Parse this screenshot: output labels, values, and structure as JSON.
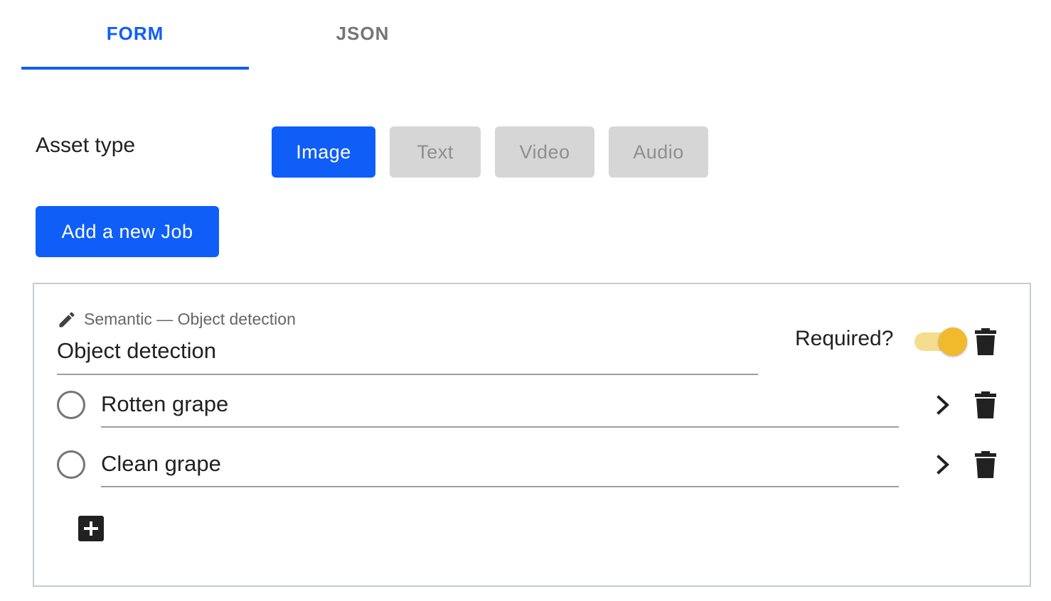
{
  "colors": {
    "accent": "#0f5ef7",
    "toggle_track": "#f5dd90",
    "toggle_thumb": "#f1b92c"
  },
  "tabs": [
    {
      "label": "FORM",
      "active": true
    },
    {
      "label": "JSON",
      "active": false
    }
  ],
  "asset_type": {
    "label": "Asset type",
    "options": [
      {
        "label": "Image",
        "active": true
      },
      {
        "label": "Text",
        "active": false
      },
      {
        "label": "Video",
        "active": false
      },
      {
        "label": "Audio",
        "active": false
      }
    ]
  },
  "add_job_label": "Add a new Job",
  "job": {
    "type_label": "Semantic — Object detection",
    "name": "Object detection",
    "required_label": "Required?",
    "required": true,
    "categories": [
      {
        "name": "Rotten grape",
        "selected": false
      },
      {
        "name": "Clean grape",
        "selected": false
      }
    ]
  },
  "icons": {
    "edit": "pencil-icon",
    "delete": "trash-icon",
    "expand": "chevron-right-icon",
    "add": "plus-icon"
  }
}
